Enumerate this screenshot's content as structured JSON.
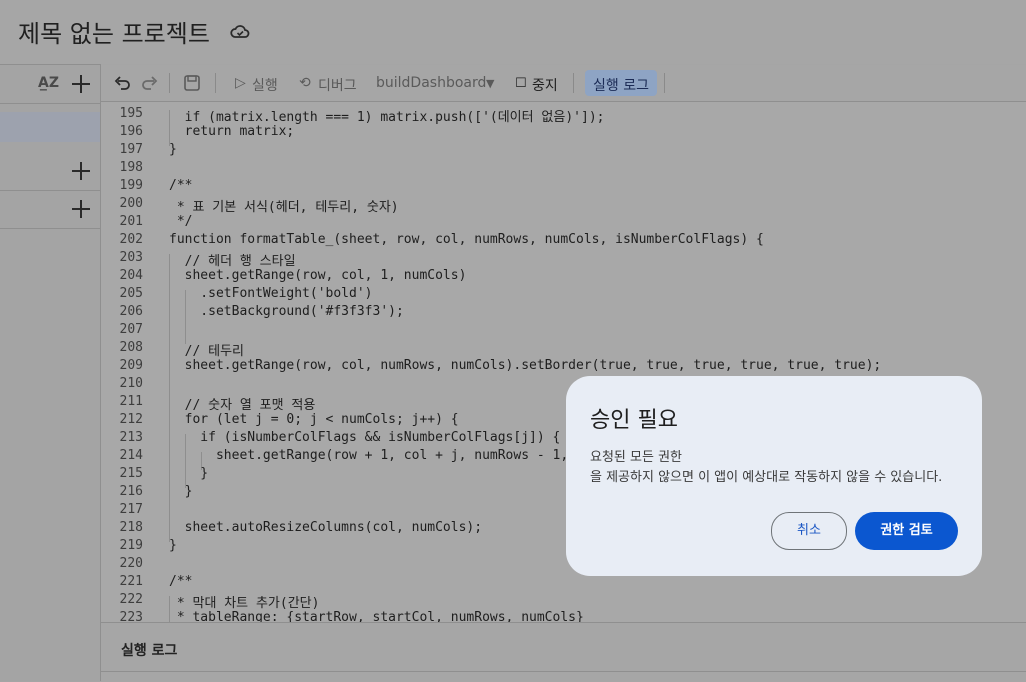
{
  "app": {
    "project_title": "제목 없는 프로젝트"
  },
  "toolbar": {
    "run_label": "실행",
    "debug_label": "디버그",
    "function_select": "buildDashboard",
    "stop_label": "중지",
    "execution_log_label": "실행 로그"
  },
  "editor": {
    "lines": [
      {
        "n": "195",
        "text": "  if (matrix.length === 1) matrix.push(['(데이터 없음)']);"
      },
      {
        "n": "196",
        "text": "  return matrix;"
      },
      {
        "n": "197",
        "text": "}"
      },
      {
        "n": "198",
        "text": ""
      },
      {
        "n": "199",
        "text": "/**"
      },
      {
        "n": "200",
        "text": " * 표 기본 서식(헤더, 테두리, 숫자)"
      },
      {
        "n": "201",
        "text": " */"
      },
      {
        "n": "202",
        "text": "function formatTable_(sheet, row, col, numRows, numCols, isNumberColFlags) {"
      },
      {
        "n": "203",
        "text": "  // 헤더 행 스타일"
      },
      {
        "n": "204",
        "text": "  sheet.getRange(row, col, 1, numCols)"
      },
      {
        "n": "205",
        "text": "    .setFontWeight('bold')"
      },
      {
        "n": "206",
        "text": "    .setBackground('#f3f3f3');"
      },
      {
        "n": "207",
        "text": ""
      },
      {
        "n": "208",
        "text": "  // 테두리"
      },
      {
        "n": "209",
        "text": "  sheet.getRange(row, col, numRows, numCols).setBorder(true, true, true, true, true, true);"
      },
      {
        "n": "210",
        "text": ""
      },
      {
        "n": "211",
        "text": "  // 숫자 열 포맷 적용"
      },
      {
        "n": "212",
        "text": "  for (let j = 0; j < numCols; j++) {"
      },
      {
        "n": "213",
        "text": "    if (isNumberColFlags && isNumberColFlags[j]) {"
      },
      {
        "n": "214",
        "text": "      sheet.getRange(row + 1, col + j, numRows - 1,"
      },
      {
        "n": "215",
        "text": "    }"
      },
      {
        "n": "216",
        "text": "  }"
      },
      {
        "n": "217",
        "text": ""
      },
      {
        "n": "218",
        "text": "  sheet.autoResizeColumns(col, numCols);"
      },
      {
        "n": "219",
        "text": "}"
      },
      {
        "n": "220",
        "text": ""
      },
      {
        "n": "221",
        "text": "/**"
      },
      {
        "n": "222",
        "text": " * 막대 차트 추가(간단)"
      },
      {
        "n": "223",
        "text": " * tableRange: {startRow, startCol, numRows, numCols}"
      }
    ]
  },
  "log_panel": {
    "label": "실행 로그"
  },
  "dialog": {
    "title": "승인 필요",
    "line1": "요청된 모든 권한",
    "line2": "을 제공하지 않으면 이 앱이 예상대로 작동하지 않을 수 있습니다.",
    "cancel_label": "취소",
    "review_label": "권한 검토"
  },
  "colors": {
    "primary_button": "#0b57d0",
    "dialog_bg": "#e8edf5"
  },
  "icons": [
    "cloud-icon",
    "sort-az-icon",
    "add-icon",
    "undo-icon",
    "redo-icon",
    "save-icon",
    "run-icon",
    "debug-icon",
    "dropdown-icon",
    "stop-icon"
  ]
}
